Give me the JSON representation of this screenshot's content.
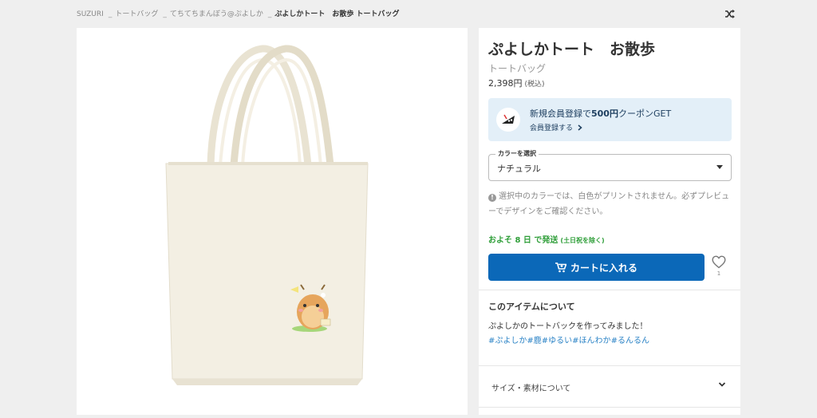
{
  "breadcrumb": {
    "items": [
      "SUZURI",
      "トートバッグ",
      "てちてちまんぼう@ぷよしか"
    ],
    "current": "ぷよしかトート　お散歩 トートバッグ"
  },
  "product": {
    "title": "ぷよしかトート　お散歩",
    "type": "トートバッグ",
    "price": "2,398円",
    "tax": "(税込)"
  },
  "coupon": {
    "text_pre": "新規会員登録で",
    "text_bold": "500円",
    "text_post": "クーポンGET",
    "link": "会員登録する"
  },
  "color_select": {
    "legend": "カラーを選択",
    "value": "ナチュラル"
  },
  "notice": "選択中のカラーでは、白色がプリントされません。必ずプレビューでデザインをご確認ください。",
  "shipping": {
    "text": "およそ 8 日 で発送",
    "note": "(土日祝を除く)"
  },
  "cart": {
    "label": "カートに入れる"
  },
  "favorite": {
    "count": "1"
  },
  "about": {
    "heading": "このアイテムについて",
    "body": "ぷよしかのトートバックを作ってみました！",
    "tags": [
      "#ぷよしか",
      "#鹿",
      "#ゆるい",
      "#ほんわか",
      "#るんるん"
    ]
  },
  "accordion": {
    "label": "サイズ・素材について"
  },
  "colors": {
    "primary": "#0b68b8",
    "shipping": "#2e9e38",
    "tag": "#2b83c6",
    "coupon_bg": "#e3eff8",
    "bag": "#f2ede0"
  },
  "icons": [
    "shuffle-icon",
    "coupon-mascot-icon",
    "chevron-right-icon",
    "caret-down-icon",
    "info-icon",
    "cart-icon",
    "heart-icon",
    "chevron-down-icon"
  ]
}
